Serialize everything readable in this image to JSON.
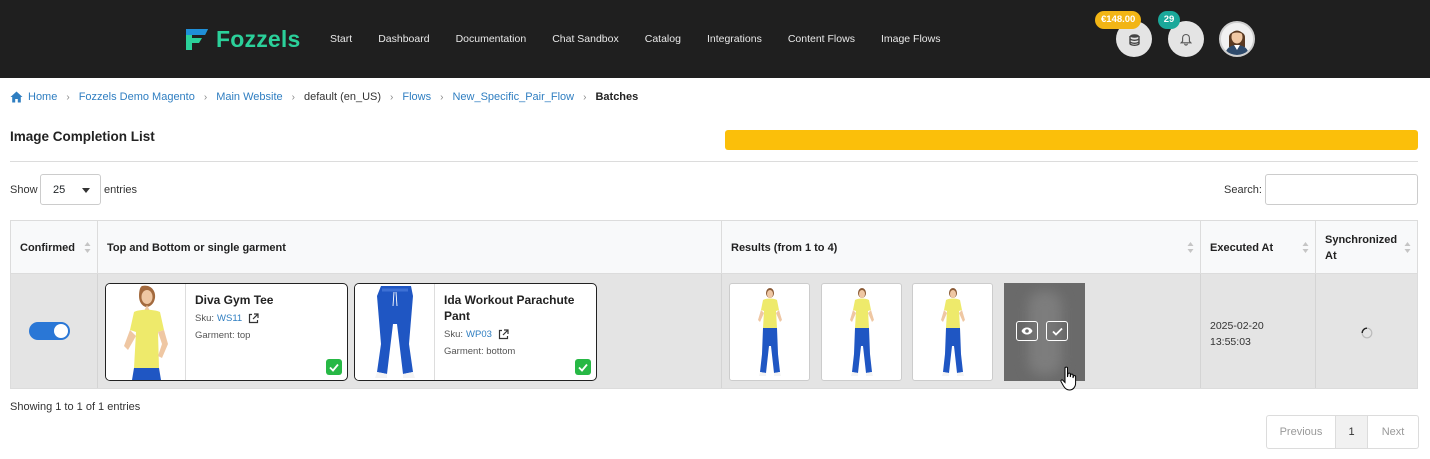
{
  "app": {
    "name": "Fozzels",
    "nav": [
      "Start",
      "Dashboard",
      "Documentation",
      "Chat Sandbox",
      "Catalog",
      "Integrations",
      "Content Flows",
      "Image Flows"
    ],
    "credit_badge": "€148.00",
    "notification_count": "29"
  },
  "breadcrumb": {
    "home": "Home",
    "items": [
      "Fozzels Demo Magento",
      "Main Website",
      "default (en_US)",
      "Flows",
      "New_Specific_Pair_Flow"
    ],
    "current": "Batches"
  },
  "page": {
    "title": "Image Completion List",
    "progress_fraction": 1.0,
    "progress_color": "#fbbf0a"
  },
  "controls": {
    "show_label": "Show",
    "entries_value": "25",
    "entries_label": "entries",
    "search_label": "Search:",
    "search_value": ""
  },
  "table": {
    "columns": {
      "confirmed": "Confirmed",
      "garment": "Top and Bottom or single garment",
      "results": "Results (from 1 to 4)",
      "executed": "Executed At",
      "synchronized": "Synchronized At"
    },
    "row": {
      "confirmed": true,
      "garments": [
        {
          "name": "Diva Gym Tee",
          "sku_label": "Sku:",
          "sku": "WS11",
          "garment_label": "Garment: top"
        },
        {
          "name": "Ida Workout Parachute Pant",
          "sku_label": "Sku:",
          "sku": "WP03",
          "garment_label": "Garment: bottom"
        }
      ],
      "executed_at": "2025-02-20 13:55:03",
      "synchronized_at": ""
    }
  },
  "footer": {
    "showing": "Showing 1 to 1 of 1 entries",
    "prev": "Previous",
    "page": "1",
    "next": "Next"
  },
  "colors": {
    "topbar": "#1f1f1f",
    "brand": "#2bd09a",
    "link": "#2f7ec1",
    "toggle_on": "#2a77d6",
    "check": "#27b845"
  }
}
